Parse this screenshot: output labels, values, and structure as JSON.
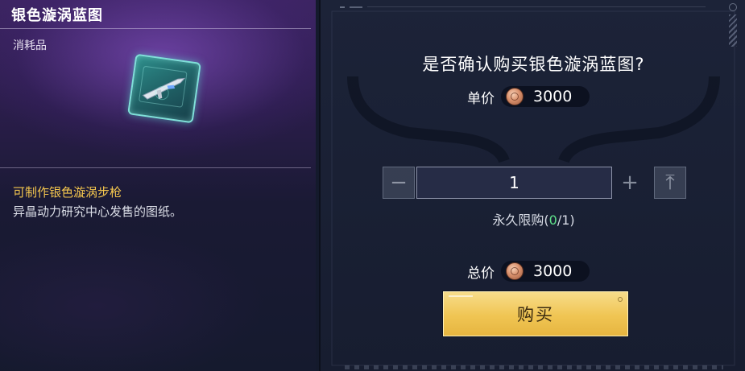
{
  "item": {
    "name": "银色漩涡蓝图",
    "category": "消耗品",
    "effect": "可制作银色漩涡步枪",
    "description": "异晶动力研究中心发售的图纸。",
    "icon": "blueprint-rifle-icon"
  },
  "purchase": {
    "question": "是否确认购买银色漩涡蓝图?",
    "unit_price_label": "单价",
    "unit_price": "3000",
    "quantity": "1",
    "limit_prefix": "永久限购(",
    "limit_bought": "0",
    "limit_rest": "/1)",
    "total_label": "总价",
    "total_price": "3000",
    "buy_label": "购买",
    "minus_symbol": "−",
    "plus_symbol": "+",
    "max_symbol": "⤒"
  },
  "colors": {
    "highlight_text": "#f4c64e",
    "limit_green": "#5fe08a",
    "buy_button": "#f0c553",
    "currency_coin": "#d9906c"
  }
}
